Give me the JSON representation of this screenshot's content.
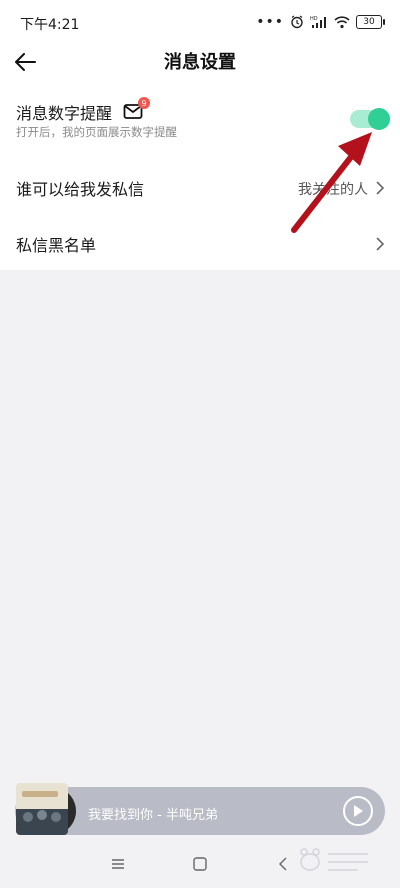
{
  "status_bar": {
    "time": "下午4:21",
    "battery": "30",
    "icons": [
      "more-dots-icon",
      "alarm-icon",
      "hd-signal-icon",
      "wifi-icon",
      "battery-icon"
    ]
  },
  "header": {
    "title": "消息设置",
    "back_icon": "back-arrow-icon"
  },
  "settings": {
    "message_badge": {
      "title": "消息数字提醒",
      "subtitle": "打开后，我的页面展示数字提醒",
      "badge_count": "9",
      "enabled": true
    },
    "private_message": {
      "title": "谁可以给我发私信",
      "value": "我关注的人"
    },
    "blacklist": {
      "title": "私信黑名单"
    }
  },
  "mini_player": {
    "track": "我要找到你 - 半吨兄弟"
  },
  "colors": {
    "accent": "#2fcf95",
    "toggle_track": "#a7ecd3",
    "badge": "#f0564f",
    "annotation": "#b3121c",
    "background": "#f2f2f5",
    "player": "#b9bbc6"
  }
}
